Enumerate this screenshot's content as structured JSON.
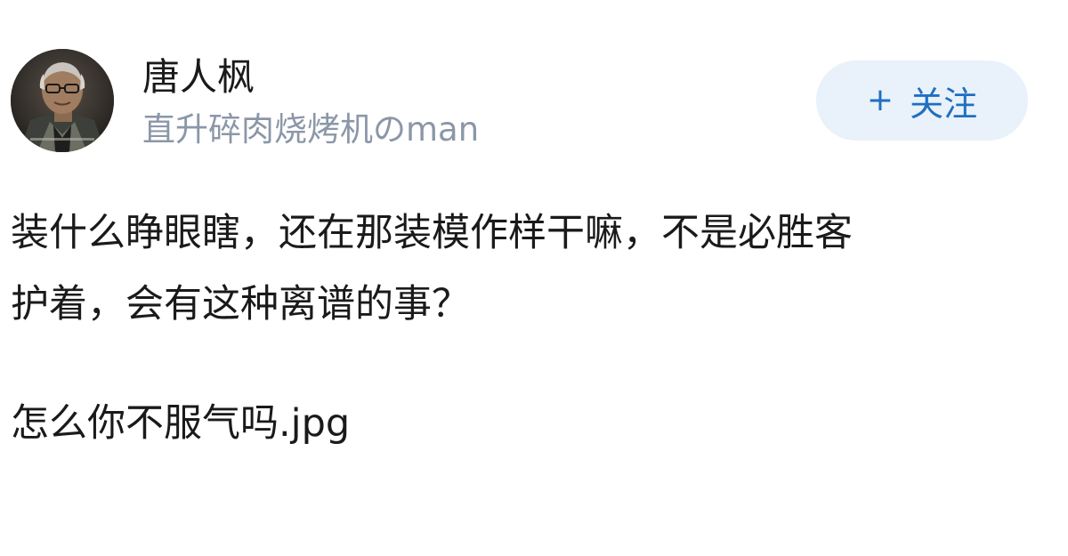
{
  "user": {
    "name": "唐人枫",
    "tagline": "直升碎肉烧烤机のman"
  },
  "follow_button": {
    "icon": "plus-icon",
    "plus": "+",
    "label": "关注",
    "background": "#e9f1fa",
    "text_color": "#1f6fc2"
  },
  "post": {
    "line1": "装什么睁眼瞎，还在那装模作样干嘛，不是必胜客",
    "line2": "护着，会有这种离谱的事？",
    "caption": "怎么你不服气吗.jpg"
  }
}
